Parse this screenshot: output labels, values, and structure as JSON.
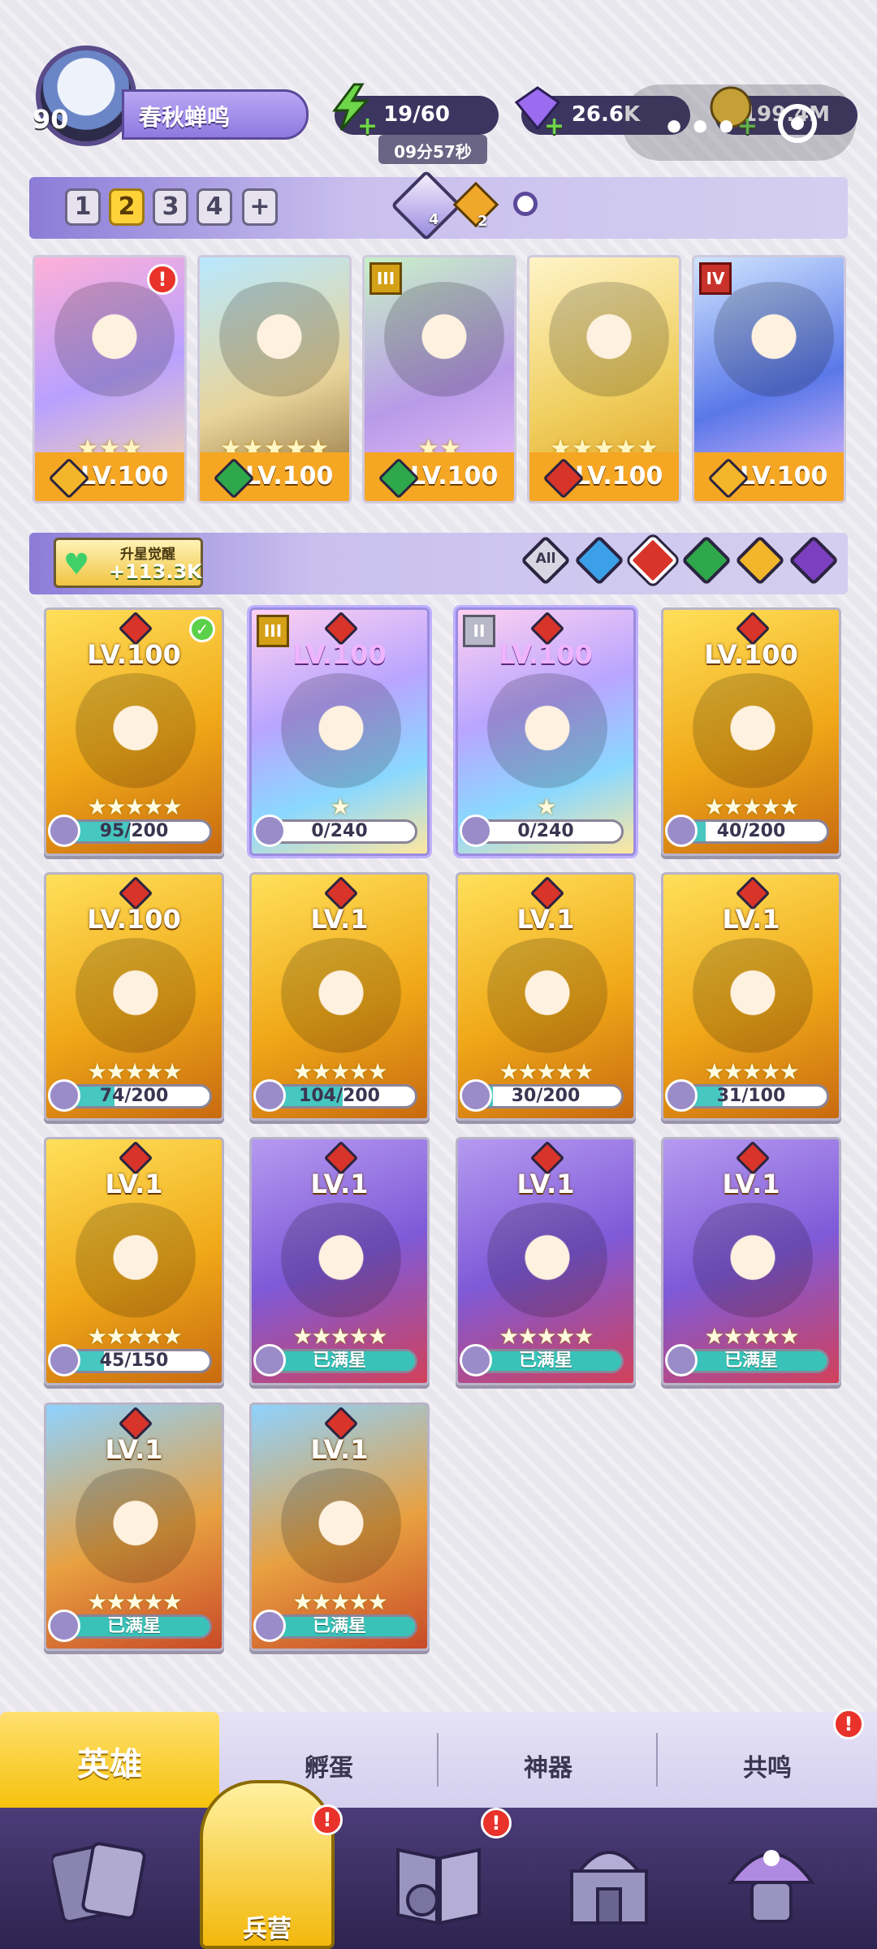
{
  "player": {
    "level": "90",
    "name": "春秋蝉鸣"
  },
  "resources": {
    "energy": "19/60",
    "energy_timer": "09分57秒",
    "diamonds": "26.6K",
    "gold": "199.4M"
  },
  "team": {
    "tabs": [
      "1",
      "2",
      "3",
      "4",
      "+"
    ],
    "active_tab": "2",
    "gem_a_count": "4",
    "gem_b_count": "2",
    "cards": [
      {
        "stars": "★★★",
        "level": "LV.100",
        "element": "light",
        "rank": "",
        "alert": "!"
      },
      {
        "stars": "★★★★★",
        "level": "LV.100",
        "element": "nature",
        "rank": "",
        "alert": ""
      },
      {
        "stars": "★★",
        "level": "LV.100",
        "element": "nature",
        "rank": "III",
        "alert": ""
      },
      {
        "stars": "★★★★★",
        "level": "LV.100",
        "element": "fire",
        "rank": "",
        "alert": ""
      },
      {
        "stars": "",
        "level": "LV.100",
        "element": "light",
        "rank": "IV",
        "alert": ""
      }
    ]
  },
  "awaken": {
    "title": "升星觉醒",
    "value": "+113.3K"
  },
  "filters": {
    "all_label": "All",
    "items": [
      "all",
      "water",
      "fire",
      "nature",
      "light",
      "dark"
    ],
    "active": "fire"
  },
  "heroes": [
    {
      "level": "LV.100",
      "progress_text": "95/200",
      "progress": 0.475,
      "stars": "★★★★★",
      "style": "gold",
      "rank": "",
      "check": "✓"
    },
    {
      "level": "LV.100",
      "progress_text": "0/240",
      "progress": 0,
      "stars": "★",
      "style": "rainbow",
      "rank": "III",
      "check": ""
    },
    {
      "level": "LV.100",
      "progress_text": "0/240",
      "progress": 0,
      "stars": "★",
      "style": "rainbow",
      "rank": "II",
      "check": ""
    },
    {
      "level": "LV.100",
      "progress_text": "40/200",
      "progress": 0.2,
      "stars": "★★★★★",
      "style": "gold",
      "rank": "",
      "check": ""
    },
    {
      "level": "LV.100",
      "progress_text": "74/200",
      "progress": 0.37,
      "stars": "★★★★★",
      "style": "gold",
      "rank": "",
      "check": ""
    },
    {
      "level": "LV.1",
      "progress_text": "104/200",
      "progress": 0.52,
      "stars": "★★★★★",
      "style": "gold",
      "rank": "",
      "check": ""
    },
    {
      "level": "LV.1",
      "progress_text": "30/200",
      "progress": 0.15,
      "stars": "★★★★★",
      "style": "gold",
      "rank": "",
      "check": ""
    },
    {
      "level": "LV.1",
      "progress_text": "31/100",
      "progress": 0.31,
      "stars": "★★★★★",
      "style": "gold",
      "rank": "",
      "check": ""
    },
    {
      "level": "LV.1",
      "progress_text": "45/150",
      "progress": 0.3,
      "stars": "★★★★★",
      "style": "gold",
      "rank": "",
      "check": ""
    },
    {
      "level": "LV.1",
      "progress_text": "已满星",
      "progress": 1,
      "stars": "★★★★★",
      "style": "purple",
      "rank": "",
      "check": ""
    },
    {
      "level": "LV.1",
      "progress_text": "已满星",
      "progress": 1,
      "stars": "★★★★★",
      "style": "purple",
      "rank": "",
      "check": ""
    },
    {
      "level": "LV.1",
      "progress_text": "已满星",
      "progress": 1,
      "stars": "★★★★★",
      "style": "purple",
      "rank": "",
      "check": ""
    },
    {
      "level": "LV.1",
      "progress_text": "已满星",
      "progress": 1,
      "stars": "★★★★★",
      "style": "blue",
      "rank": "",
      "check": ""
    },
    {
      "level": "LV.1",
      "progress_text": "已满星",
      "progress": 1,
      "stars": "★★★★★",
      "style": "blue",
      "rank": "",
      "check": ""
    }
  ],
  "subtabs": {
    "heroes": "英雄",
    "hatch": "孵蛋",
    "artifacts": "神器",
    "resonance": "共鸣",
    "resonance_alert": "!"
  },
  "nav": {
    "barracks": "兵营",
    "barracks_alert": "!",
    "map_alert": "!"
  }
}
